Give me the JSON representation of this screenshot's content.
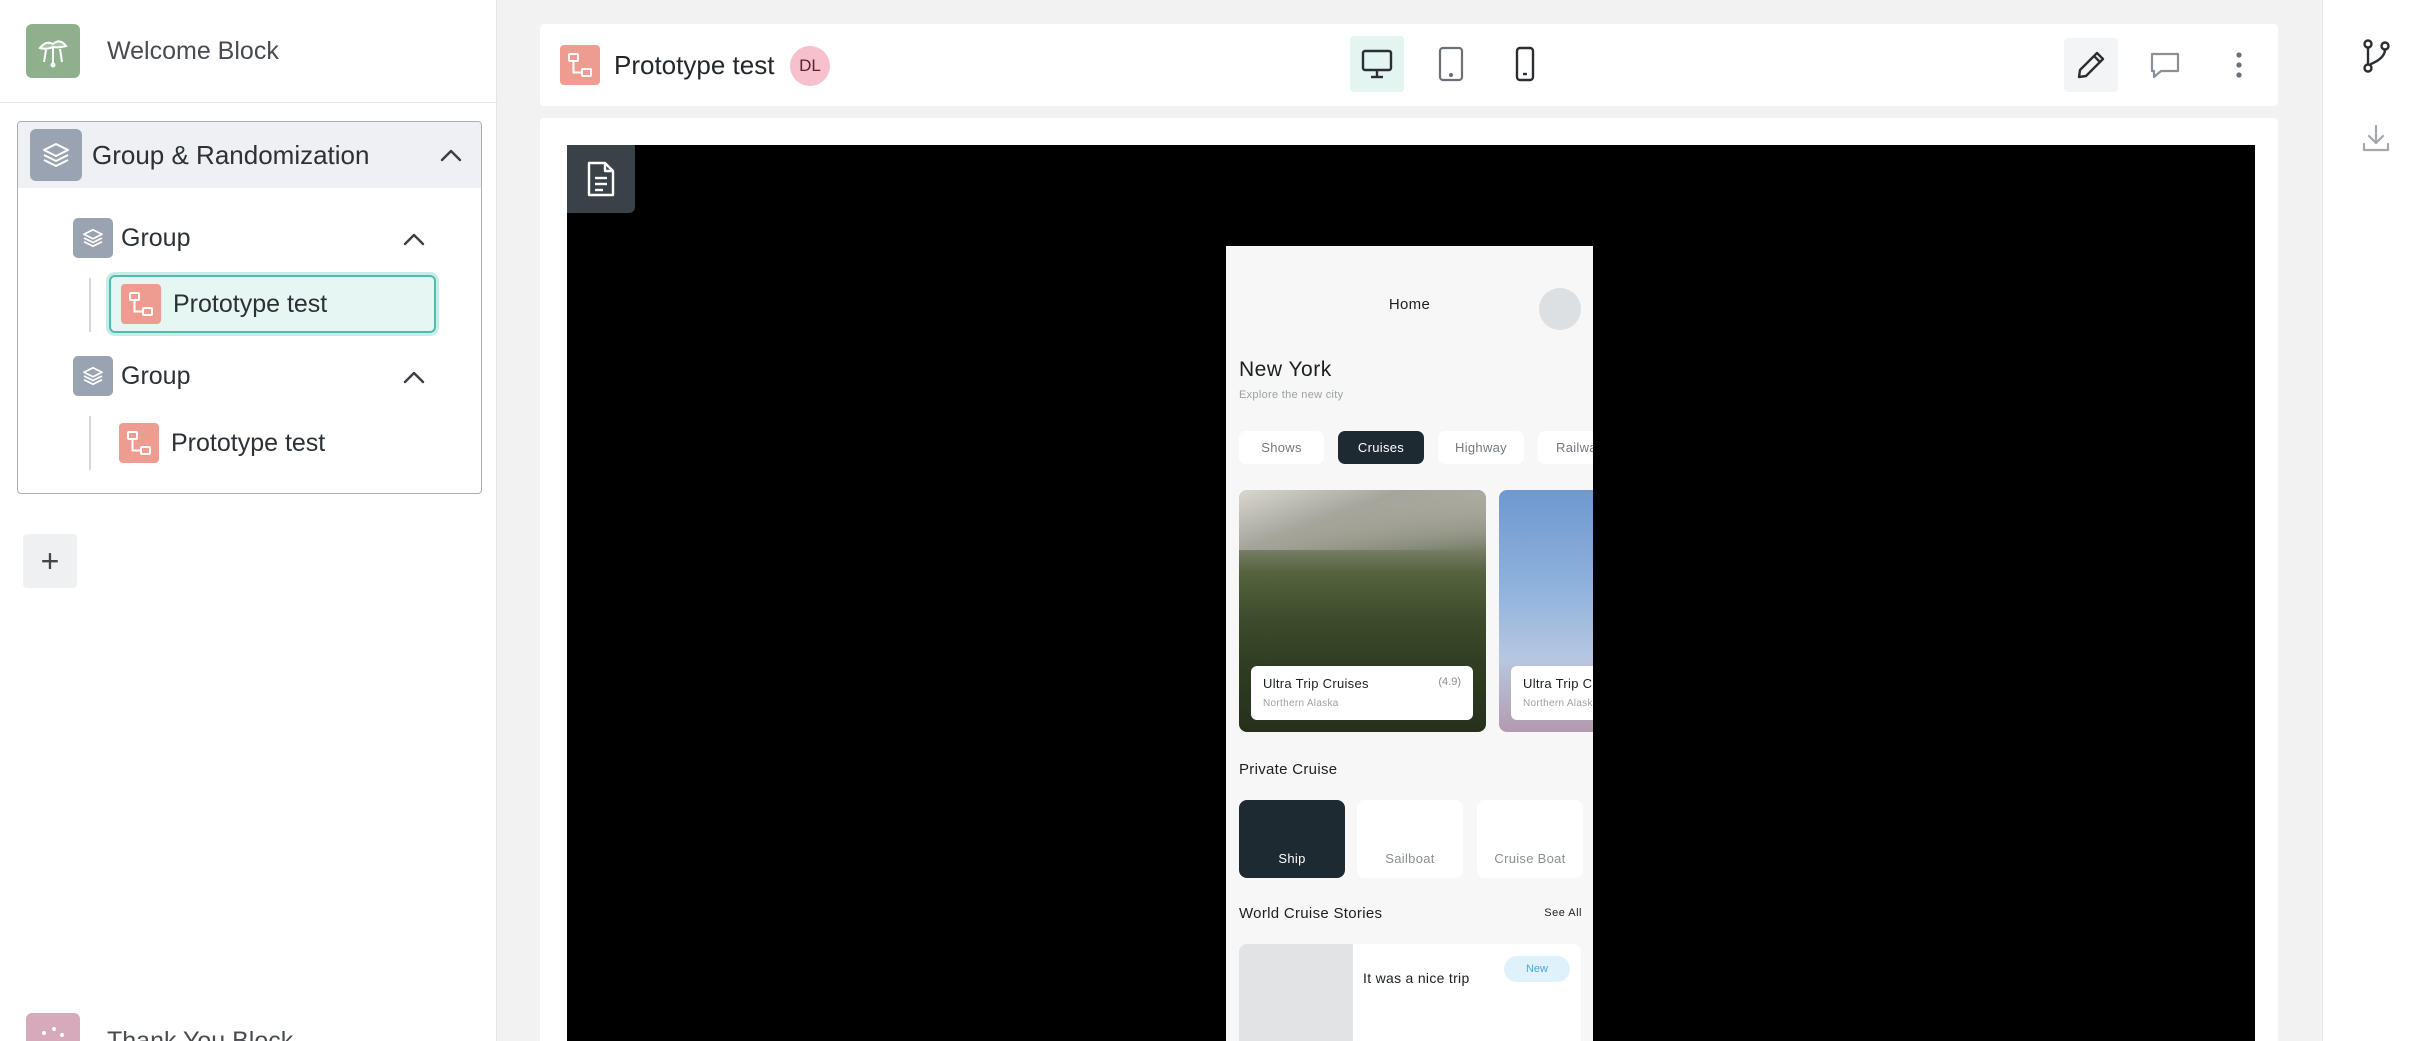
{
  "sidebar": {
    "welcome_label": "Welcome Block",
    "group_randomization_label": "Group & Randomization",
    "groups": [
      {
        "label": "Group",
        "item_label": "Prototype test"
      },
      {
        "label": "Group",
        "item_label": "Prototype test"
      }
    ],
    "add_label": "+",
    "thank_you_label": "Thank You Block"
  },
  "topbar": {
    "title": "Prototype test",
    "badge": "DL"
  },
  "phone": {
    "home_title": "Home",
    "city": "New York",
    "subtitle": "Explore the new city",
    "chips": [
      "Shows",
      "Cruises",
      "Highway",
      "Railway"
    ],
    "cards": [
      {
        "name": "Ultra Trip Cruises",
        "rating": "(4.9)",
        "location": "Northern Alaska"
      },
      {
        "name": "Ultra Trip Cruises",
        "location": "Northern Alaska"
      }
    ],
    "private_cruise_title": "Private Cruise",
    "private_options": [
      "Ship",
      "Sailboat",
      "Cruise Boat"
    ],
    "stories_title": "World Cruise Stories",
    "see_all": "See All",
    "story_title": "It was a nice trip",
    "story_badge": "New"
  },
  "colors": {
    "accent": "#4fbcad",
    "prototype_icon": "#ef9c90",
    "group_icon": "#9aa3b2",
    "phone_dark": "#1e2a32"
  }
}
